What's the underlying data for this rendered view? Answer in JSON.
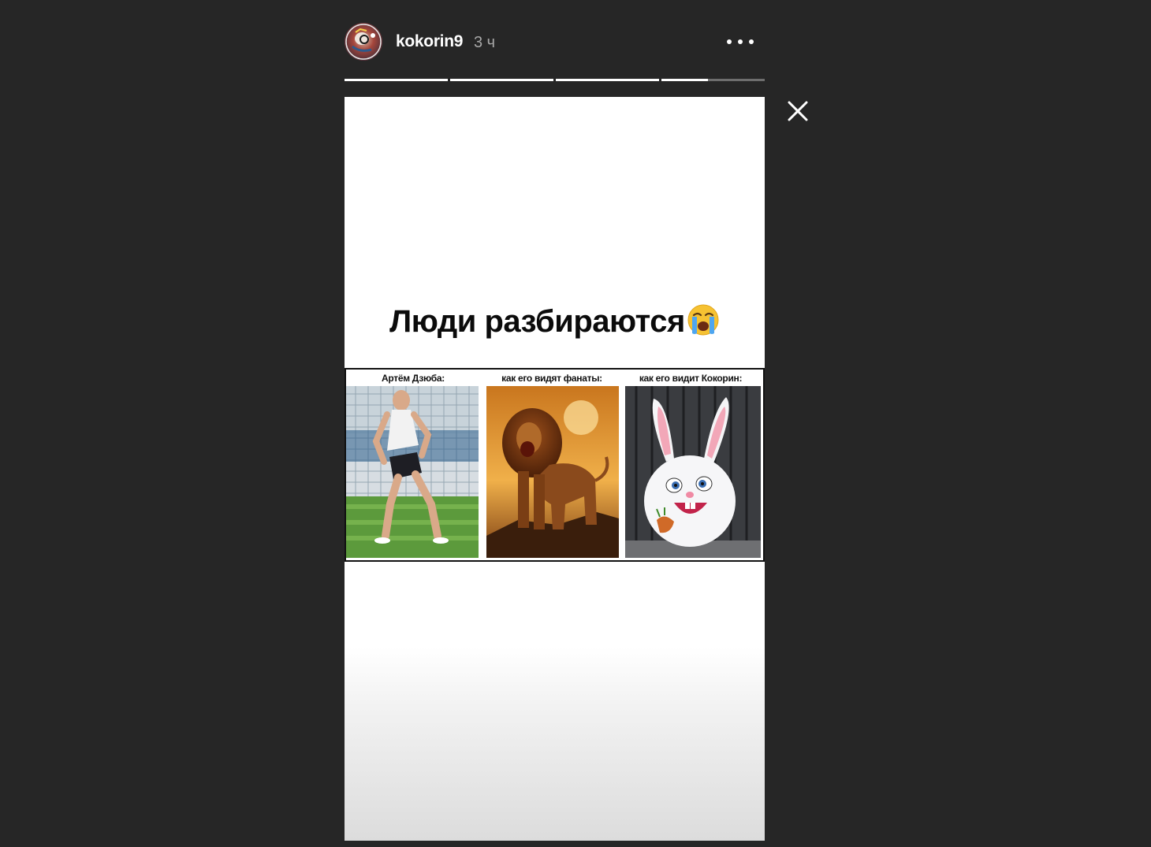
{
  "header": {
    "username": "kokorin9",
    "timestamp": "3 ч"
  },
  "progress": {
    "segments": [
      1,
      1,
      1,
      0.45
    ]
  },
  "story": {
    "caption": "Люди разбираются",
    "caption_emoji": "loudly-crying-face-icon",
    "meme": {
      "panels": [
        {
          "label": "Артём Дзюба:",
          "image": "football player on pitch"
        },
        {
          "label": "как его видят фанаты:",
          "image": "roaring lion"
        },
        {
          "label": "как его видит Кокорин:",
          "image": "white cartoon rabbit"
        }
      ]
    }
  },
  "colors": {
    "background": "#262626",
    "progress_active": "#ffffff",
    "progress_inactive": "#6e6e6e"
  }
}
